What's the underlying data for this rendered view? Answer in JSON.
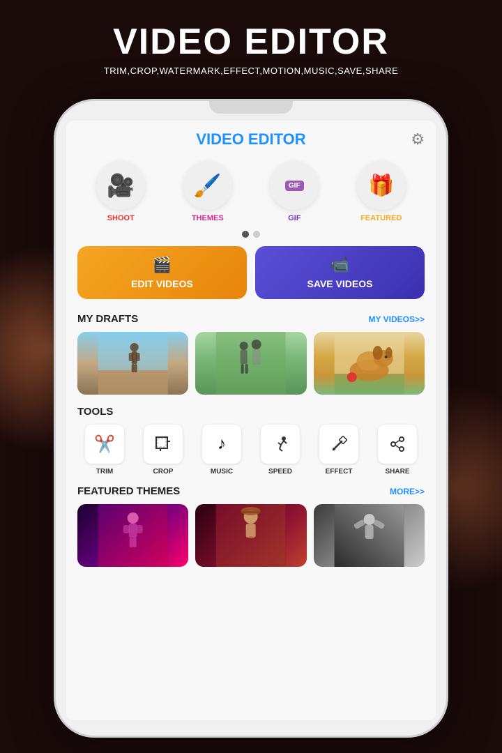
{
  "header": {
    "title": "VIDEO EDITOR",
    "subtitle": "TRIM,CROP,WATERMARK,EFFECT,MOTION,MUSIC,SAVE,SHARE"
  },
  "app": {
    "title": "VIDEO EDITOR",
    "settings_icon": "⚙"
  },
  "features": [
    {
      "id": "shoot",
      "icon": "🎥",
      "label": "SHOOT",
      "color": "red"
    },
    {
      "id": "themes",
      "icon": "🖌",
      "label": "THEMES",
      "color": "pink"
    },
    {
      "id": "gif",
      "icon": "GIF",
      "label": "GIF",
      "color": "purple"
    },
    {
      "id": "featured",
      "icon": "🎁",
      "label": "FEATURED",
      "color": "orange"
    }
  ],
  "action_buttons": {
    "edit": {
      "label": "EDIT VIDEOS",
      "icon": "🎬"
    },
    "save": {
      "label": "SAVE VIDEOS",
      "icon": "📹"
    }
  },
  "drafts": {
    "title": "MY DRAFTS",
    "link": "MY VIDEOS>>",
    "items": [
      {
        "id": "draft-1",
        "alt": "Person on rock at beach"
      },
      {
        "id": "draft-2",
        "alt": "Couple in garden"
      },
      {
        "id": "draft-3",
        "alt": "Golden retriever dog"
      }
    ]
  },
  "tools": {
    "title": "TOOLS",
    "items": [
      {
        "id": "trim",
        "icon": "✂",
        "label": "TRIM"
      },
      {
        "id": "crop",
        "icon": "⬚",
        "label": "CROP"
      },
      {
        "id": "music",
        "icon": "♪",
        "label": "MUSIC"
      },
      {
        "id": "speed",
        "icon": "⚡",
        "label": "SPEED"
      },
      {
        "id": "effect",
        "icon": "✏",
        "label": "EFFECT"
      },
      {
        "id": "share",
        "icon": "⇪",
        "label": "SHARE"
      }
    ]
  },
  "featured_themes": {
    "title": "FEATURED THEMES",
    "link": "MORE>>",
    "items": [
      {
        "id": "theme-1",
        "alt": "Neon club theme"
      },
      {
        "id": "theme-2",
        "alt": "Warm portrait theme"
      },
      {
        "id": "theme-3",
        "alt": "Monochrome theme"
      }
    ]
  }
}
